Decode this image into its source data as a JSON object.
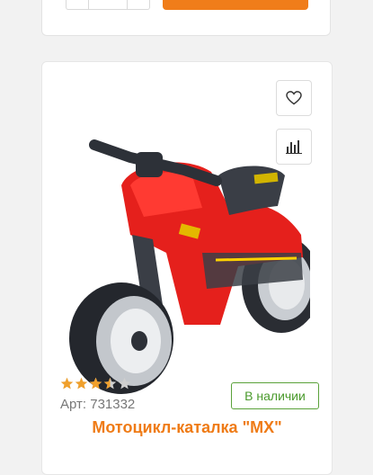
{
  "colors": {
    "accent": "#f07d1a",
    "title": "#ef7b16",
    "in_stock": "#4a9a2c",
    "star_filled": "#f0a02c",
    "star_empty": "#cfcfcf"
  },
  "product": {
    "rating": 3.5,
    "rating_max": 5,
    "sku": "Арт: 731332",
    "availability": "В наличии",
    "title": "Мотоцикл-каталка \"МХ\"",
    "image_icon": "red-motorcycle-ride-on-toy"
  },
  "icons": {
    "favorite": "heart-icon",
    "compare": "bar-chart-icon"
  }
}
